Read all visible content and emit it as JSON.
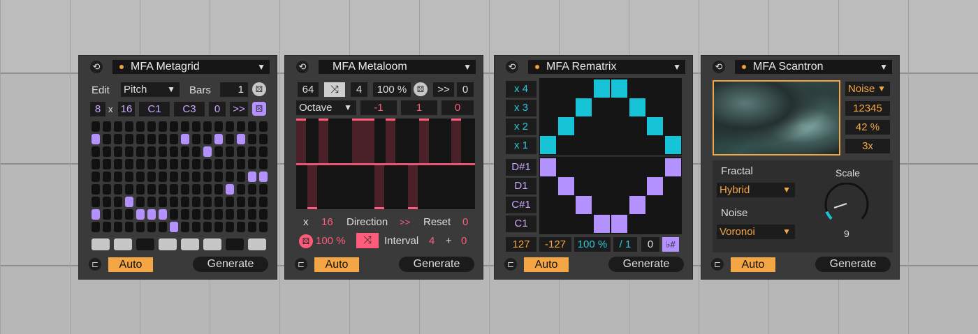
{
  "devices": [
    {
      "title": "MFA Metagrid",
      "edit_label": "Edit",
      "mode": "Pitch",
      "bars_label": "Bars",
      "bars": "1",
      "steps": "8",
      "x": "x",
      "length": "16",
      "low": "C1",
      "high": "C3",
      "offset": "0",
      "dir": ">>",
      "auto": "Auto",
      "generate": "Generate"
    },
    {
      "title": "MFA Metaloom",
      "v1": "64",
      "v2": "4",
      "v3": "100 %",
      "v4": ">>",
      "v5": "0",
      "param": "Octave",
      "p1": "-1",
      "p2": "1",
      "p3": "0",
      "x": "x",
      "len": "16",
      "direction": "Direction",
      "dirv": ">>",
      "reset": "Reset",
      "resetv": "0",
      "prob": "100 %",
      "interval": "Interval",
      "iv": "4",
      "plus": "+",
      "pv": "0",
      "auto": "Auto",
      "generate": "Generate"
    },
    {
      "title": "MFA Rematrix",
      "rows": [
        "x 4",
        "x 3",
        "x 2",
        "x 1",
        "D#1",
        "D1",
        "C#1",
        "C1"
      ],
      "b1": "127",
      "b2": "-127",
      "b3": "100 %",
      "b4": "/ 1",
      "b5": "0",
      "b6": "♭#",
      "auto": "Auto",
      "generate": "Generate"
    },
    {
      "title": "MFA Scantron",
      "type": "Noise",
      "seed": "12345",
      "amount": "42 %",
      "speed": "3x",
      "fractal_label": "Fractal",
      "fractal": "Hybrid",
      "noise_label": "Noise",
      "noise": "Voronoi",
      "scale_label": "Scale",
      "scale": "9",
      "auto": "Auto",
      "generate": "Generate"
    }
  ],
  "colors": {
    "orange": "#f5a644",
    "purple": "#b391ff",
    "cyan": "#17c3d6",
    "pink": "#ff5c7c"
  }
}
